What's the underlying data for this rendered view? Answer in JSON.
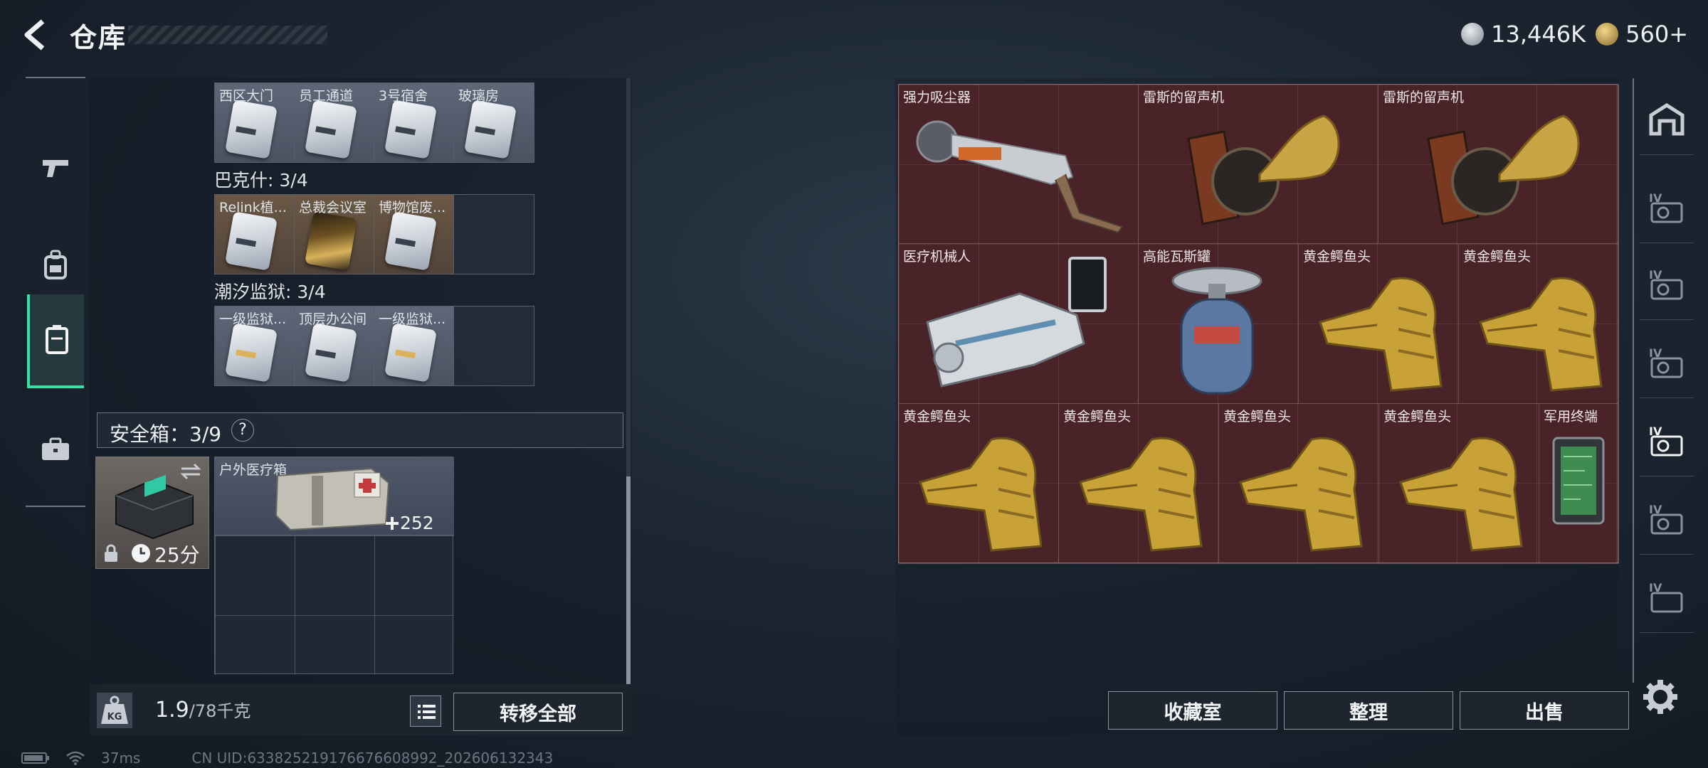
{
  "header": {
    "title": "仓库"
  },
  "currency": [
    {
      "icon": "silver-coin-icon",
      "amount": "13,446K",
      "color": "#b9c0c7"
    },
    {
      "icon": "gold-triangle-coin-icon",
      "amount": "560+",
      "color": "#d9b25a"
    }
  ],
  "left_nav": [
    {
      "icon": "pistol-icon",
      "active": false
    },
    {
      "icon": "backpack-icon",
      "active": false
    },
    {
      "icon": "container-icon",
      "active": true
    },
    {
      "icon": "briefcase-icon",
      "active": false
    }
  ],
  "keycards": {
    "row1": [
      "西区大门",
      "员工通道",
      "3号宿舍",
      "玻璃房"
    ],
    "group2_title": "巴克什: 3/4",
    "row2": [
      "Relink植...",
      "总裁会议室",
      "博物馆废..."
    ],
    "group3_title": "潮汐监狱: 3/4",
    "row3": [
      "一级监狱...",
      "顶层办公间",
      "一级监狱..."
    ]
  },
  "safe_box": {
    "label": "安全箱：3/9",
    "help": "?",
    "timer": "25分",
    "item_label": "户外医疗箱",
    "item_count": "252"
  },
  "footer_left": {
    "weight_icon_label": "KG",
    "weight": "1.9",
    "weight_unit": "/78千克",
    "transfer_all": "转移全部"
  },
  "stash_items": [
    {
      "label": "强力吸尘器",
      "icon": "vacuum-icon"
    },
    {
      "label": "雷斯的留声机",
      "icon": "gramophone-icon"
    },
    {
      "label": "雷斯的留声机",
      "icon": "gramophone-icon"
    },
    {
      "label": "医疗机械人",
      "icon": "medical-robot-icon"
    },
    {
      "label": "高能瓦斯罐",
      "icon": "gas-canister-icon"
    },
    {
      "label": "黄金鳄鱼头",
      "icon": "gold-crocodile-head-icon"
    },
    {
      "label": "黄金鳄鱼头",
      "icon": "gold-crocodile-head-icon"
    },
    {
      "label": "黄金鳄鱼头",
      "icon": "gold-crocodile-head-icon"
    },
    {
      "label": "黄金鳄鱼头",
      "icon": "gold-crocodile-head-icon"
    },
    {
      "label": "黄金鳄鱼头",
      "icon": "gold-crocodile-head-icon"
    },
    {
      "label": "黄金鳄鱼头",
      "icon": "gold-crocodile-head-icon"
    },
    {
      "label": "军用终端",
      "icon": "military-terminal-icon"
    }
  ],
  "right_buttons": {
    "collection": "收藏室",
    "organize": "整理",
    "sell": "出售"
  },
  "right_nav": [
    {
      "icon": "vault-icon",
      "tier": ""
    },
    {
      "icon": "stash-tier-icon",
      "tier": "IV"
    },
    {
      "icon": "stash-tier-icon",
      "tier": "IV"
    },
    {
      "icon": "stash-tier-icon",
      "tier": "IV"
    },
    {
      "icon": "stash-tier-icon",
      "tier": "IV",
      "active": true
    },
    {
      "icon": "stash-tier-icon",
      "tier": "IV"
    },
    {
      "icon": "stash-tier-icon",
      "tier": "IV"
    }
  ],
  "status": {
    "ping": "37ms",
    "uid": "CN UID:633825219176676608992_202606132343"
  }
}
